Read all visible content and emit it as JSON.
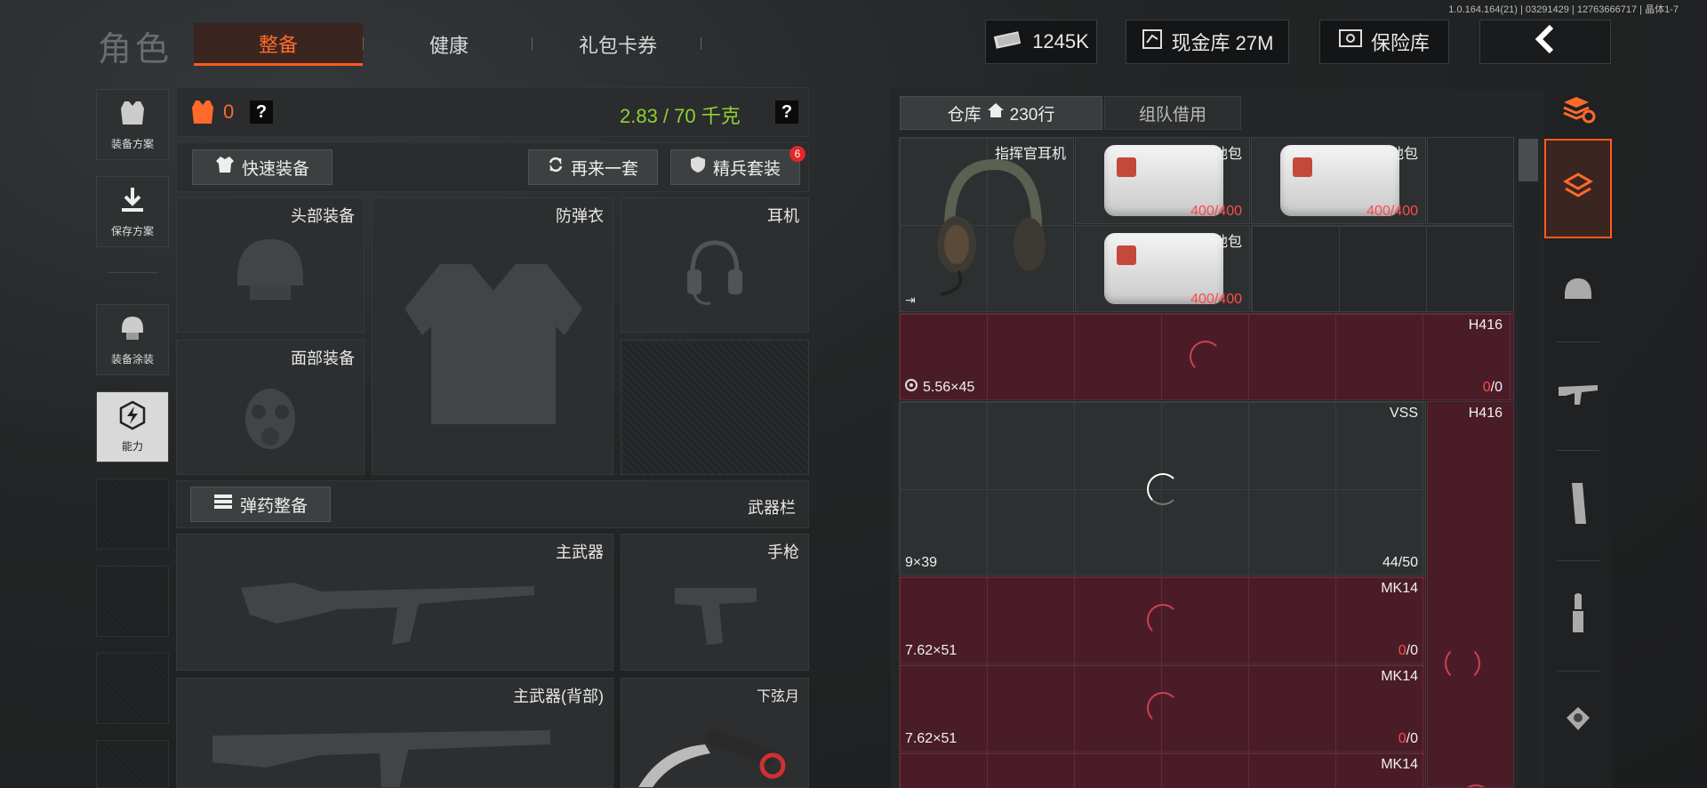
{
  "version": "1.0.164.164(21) | 03291429 | 12763666717 | 晶体1-7",
  "header": {
    "title": "角色",
    "tabs": [
      {
        "label": "整备",
        "active": true
      },
      {
        "label": "健康",
        "active": false
      },
      {
        "label": "礼包卡券",
        "active": false
      }
    ],
    "money": "1245K",
    "cash_vault": "现金库 27M",
    "safe": "保险库"
  },
  "left_sidebar": {
    "items": [
      {
        "label": "装备方案"
      },
      {
        "label": "保存方案"
      },
      {
        "label": "装备涂装"
      },
      {
        "label": "能力"
      }
    ]
  },
  "loadout": {
    "armor_count": "0",
    "weight": "2.83 / 70 千克",
    "quick_equip": "快速装备",
    "again_set": "再来一套",
    "elite_set": "精兵套装",
    "elite_badge": "6",
    "slots": {
      "head": "头部装备",
      "vest": "防弹衣",
      "headset": "耳机",
      "face": "面部装备",
      "ammo_btn": "弹药整备",
      "weapon_bar": "武器栏",
      "primary": "主武器",
      "pistol": "手枪",
      "primary_back": "主武器(背部)",
      "melee": "下弦月"
    }
  },
  "storage": {
    "tab_warehouse": "仓库",
    "rows": "230行",
    "tab_team": "组队借用",
    "items": [
      {
        "name": "指挥官耳机"
      },
      {
        "name": "100D战地包",
        "count": "400/400"
      },
      {
        "name": "100D战地包",
        "count": "400/400"
      },
      {
        "name": "100D战地包",
        "count": "400/400"
      }
    ],
    "weapons": [
      {
        "name": "H416",
        "caliber": "5.56×45",
        "count_a": "0",
        "count_b": "/0"
      },
      {
        "name": "VSS",
        "caliber": "9×39",
        "count": "44/50"
      },
      {
        "name": "H416"
      },
      {
        "name": "MK14",
        "caliber": "7.62×51",
        "count_a": "0",
        "count_b": "/0"
      },
      {
        "name": "MK14",
        "caliber": "7.62×51",
        "count_a": "0",
        "count_b": "/0"
      },
      {
        "name": "MK14"
      }
    ]
  }
}
